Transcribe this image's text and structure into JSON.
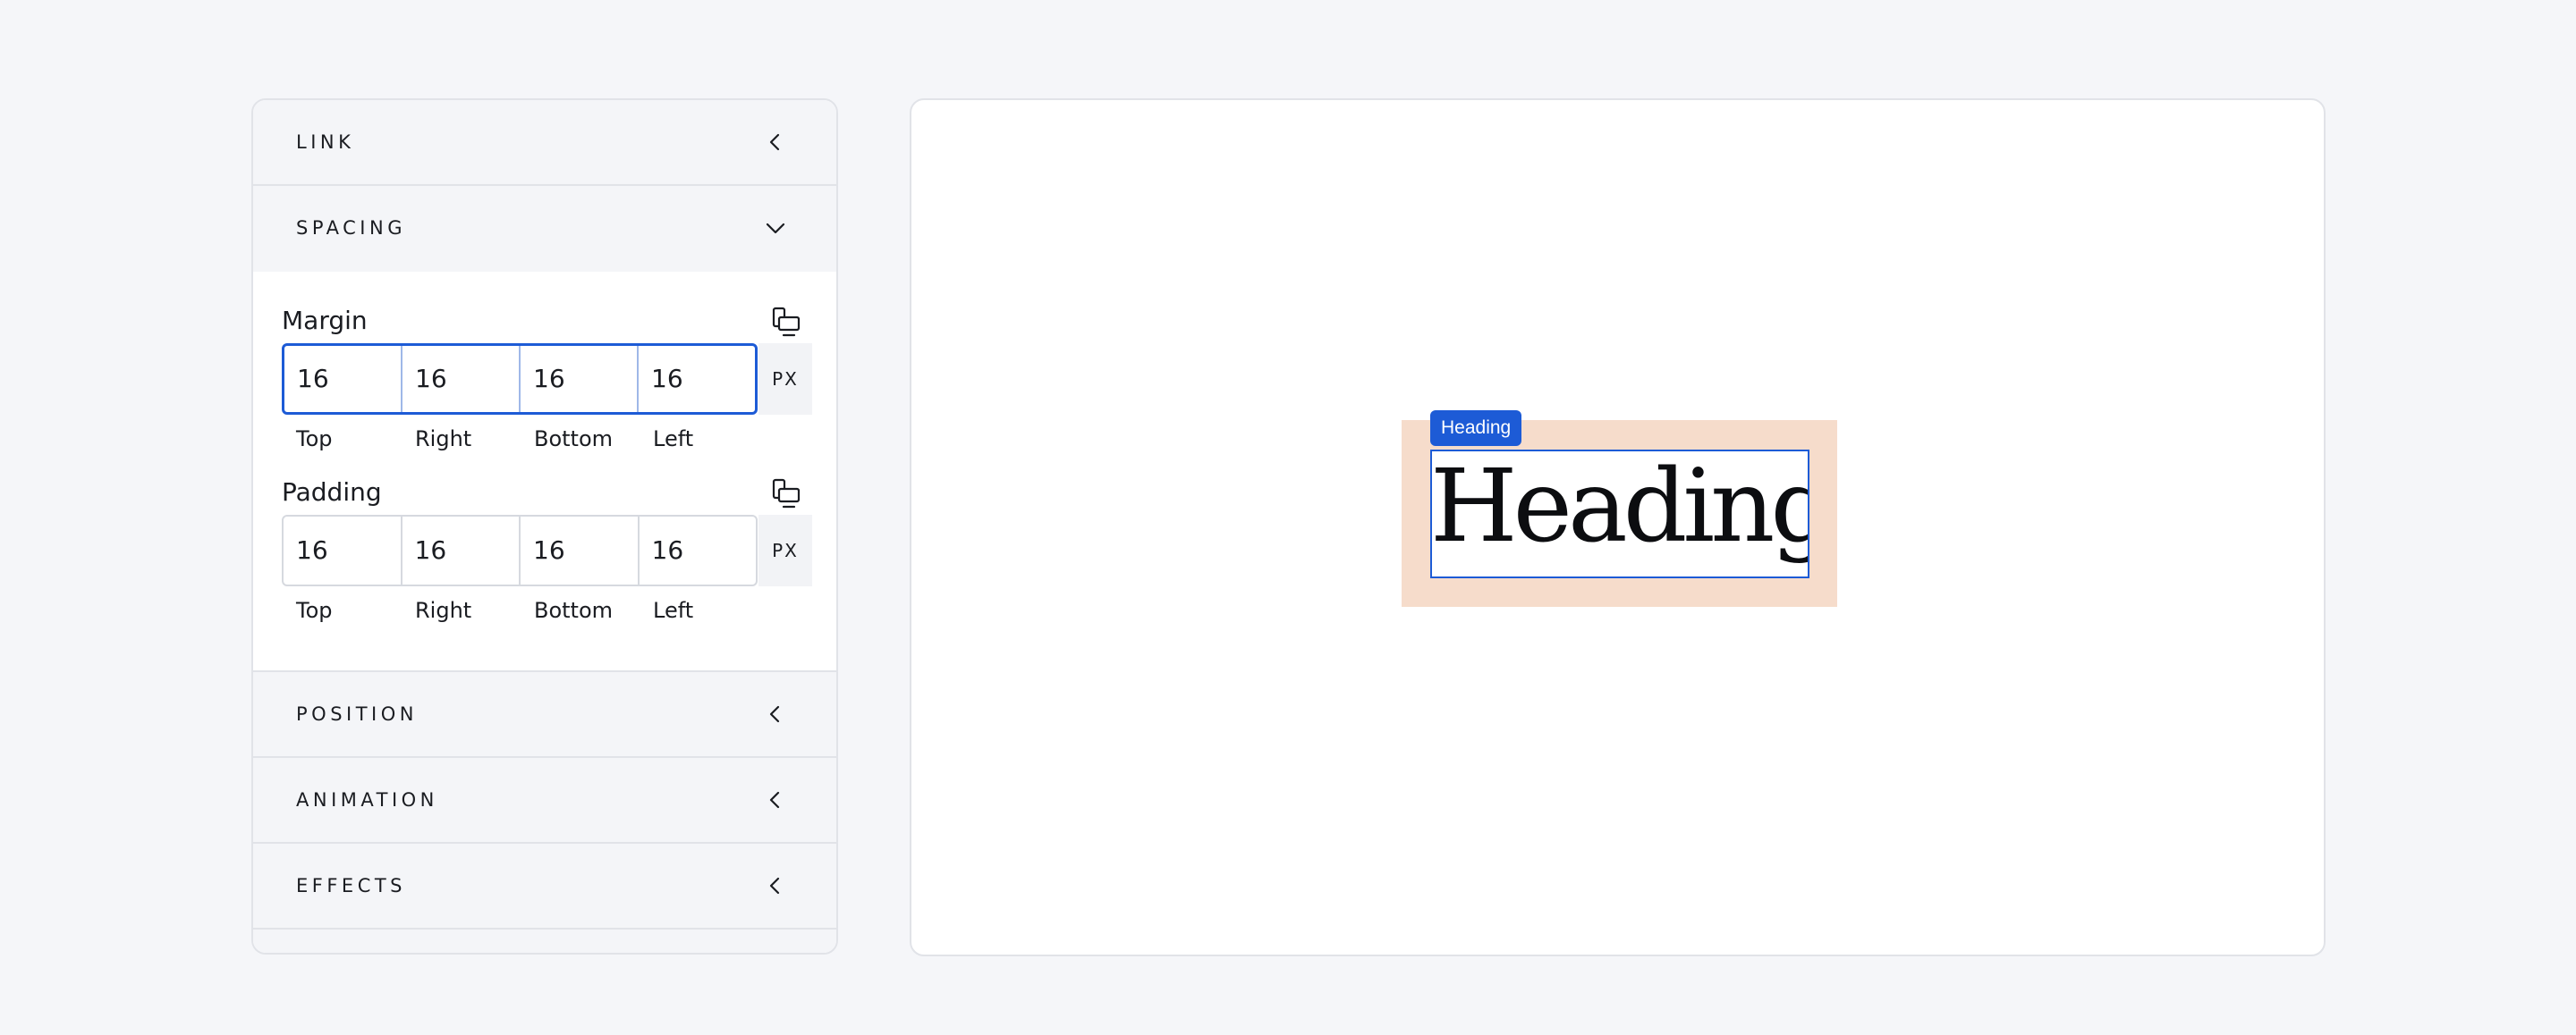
{
  "panel": {
    "sections_top": [
      {
        "title": "LINK",
        "expanded": false,
        "chevron": "chevron-left-icon"
      },
      {
        "title": "SPACING",
        "expanded": true,
        "chevron": "chevron-down-icon"
      }
    ],
    "spacing": {
      "margin": {
        "label": "Margin",
        "values": [
          "16",
          "16",
          "16",
          "16"
        ],
        "sides": [
          "Top",
          "Right",
          "Bottom",
          "Left"
        ],
        "unit": "PX",
        "link_icon": "link-sides-icon",
        "focused": true
      },
      "padding": {
        "label": "Padding",
        "values": [
          "16",
          "16",
          "16",
          "16"
        ],
        "sides": [
          "Top",
          "Right",
          "Bottom",
          "Left"
        ],
        "unit": "PX",
        "link_icon": "link-sides-icon",
        "focused": false
      }
    },
    "sections_bottom": [
      {
        "title": "POSITION",
        "expanded": false,
        "chevron": "chevron-left-icon"
      },
      {
        "title": "ANIMATION",
        "expanded": false,
        "chevron": "chevron-left-icon"
      },
      {
        "title": "EFFECTS",
        "expanded": false,
        "chevron": "chevron-left-icon"
      }
    ]
  },
  "canvas": {
    "badge": "Heading",
    "heading_text": "Heading",
    "colors": {
      "selection": "#1d5bd6",
      "margin_overlay": "#f6dccb",
      "background": "#f5f6f9"
    }
  }
}
